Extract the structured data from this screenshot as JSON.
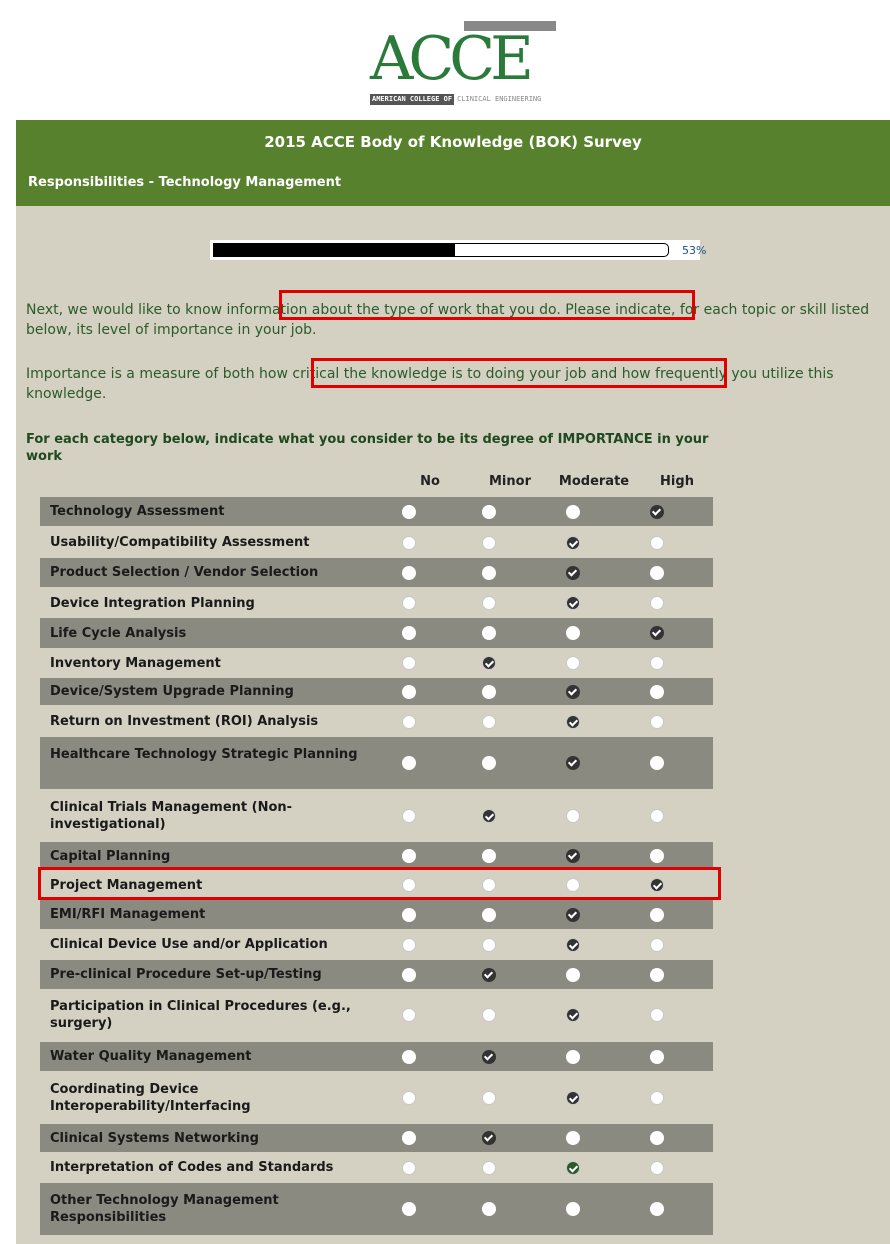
{
  "logo": {
    "main": "ACCE",
    "sub_dark": "AMERICAN COLLEGE OF",
    "sub_light": "CLINICAL ENGINEERING"
  },
  "header": {
    "survey_title": "2015 ACCE Body of Knowledge (BOK) Survey",
    "section_title": "Responsibilities - Technology Management"
  },
  "progress": {
    "percent": 53,
    "label": "53%"
  },
  "intro": {
    "p1": "Next, we would like to know information about the type of work that you do. Please indicate, for each topic or skill listed below, its level of importance in your job.",
    "p2": "Importance is a measure of both how critical the knowledge is to doing your job and how frequently you utilize this knowledge."
  },
  "question": {
    "instructions": "For each category below, indicate what you consider to be its degree of IMPORTANCE in your work"
  },
  "columns": [
    "No",
    "Minor",
    "Moderate",
    "High"
  ],
  "rows": [
    {
      "label": "Technology Assessment",
      "selected": 3
    },
    {
      "label": "Usability/Compatibility Assessment",
      "selected": 2
    },
    {
      "label": "Product Selection / Vendor Selection",
      "selected": 2
    },
    {
      "label": "Device Integration Planning",
      "selected": 2
    },
    {
      "label": "Life Cycle Analysis",
      "selected": 3
    },
    {
      "label": "Inventory Management",
      "selected": 1
    },
    {
      "label": "Device/System Upgrade Planning",
      "selected": 2
    },
    {
      "label": "Return on Investment (ROI) Analysis",
      "selected": 2
    },
    {
      "label": "Healthcare Technology Strategic Planning",
      "selected": 2
    },
    {
      "label": "Clinical Trials Management (Non-investigational)",
      "selected": 1
    },
    {
      "label": "Capital Planning",
      "selected": 2
    },
    {
      "label": "Project Management",
      "selected": 3
    },
    {
      "label": "EMI/RFI Management",
      "selected": 2
    },
    {
      "label": "Clinical Device Use and/or Application",
      "selected": 2
    },
    {
      "label": "Pre-clinical Procedure Set-up/Testing",
      "selected": 1
    },
    {
      "label": "Participation in Clinical Procedures (e.g., surgery)",
      "selected": 2
    },
    {
      "label": "Water Quality Management",
      "selected": 1
    },
    {
      "label": "Coordinating Device Interoperability/Interfacing",
      "selected": 2
    },
    {
      "label": "Clinical Systems Networking",
      "selected": 1
    },
    {
      "label": "Interpretation of Codes and Standards",
      "selected": 2
    },
    {
      "label": "Other Technology Management Responsibilities",
      "selected": null
    }
  ]
}
